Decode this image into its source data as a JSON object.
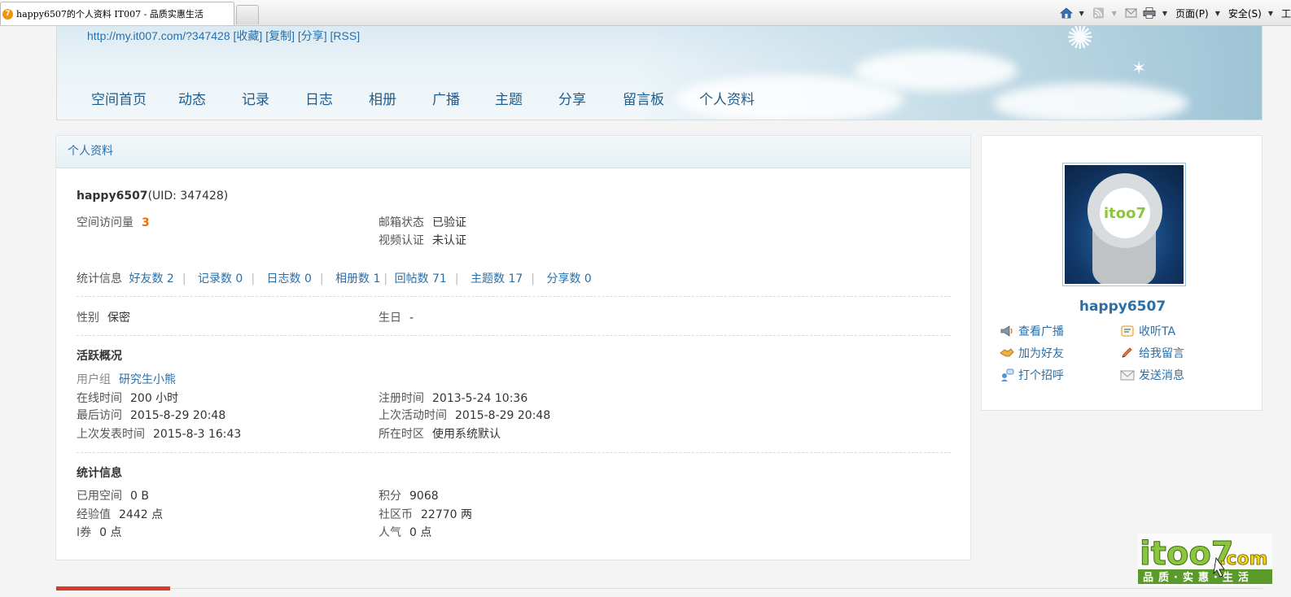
{
  "browser": {
    "tab_title": "happy6507的个人资料 IT007 - 品质实惠生活",
    "favicon_glyph": "7",
    "menu_page": "页面(P)",
    "menu_safety": "安全(S)",
    "menu_tools": "工"
  },
  "banner": {
    "url": "http://my.it007.com/?347428",
    "actions": [
      "[收藏]",
      "[复制]",
      "[分享]",
      "[RSS]"
    ]
  },
  "nav": [
    "空间首页",
    "动态",
    "记录",
    "日志",
    "相册",
    "广播",
    "主题",
    "分享",
    "留言板",
    "个人资料"
  ],
  "panel": {
    "title": "个人资料",
    "username": "happy6507",
    "uid": "(UID: 347428)",
    "visits_label": "空间访问量",
    "visits_value": "3",
    "email_label": "邮箱状态",
    "email_value": "已验证",
    "video_label": "视频认证",
    "video_value": "未认证",
    "stats_label": "统计信息",
    "stats": [
      "好友数 2",
      "记录数 0",
      "日志数 0",
      "相册数 1",
      "回帖数 71",
      "主题数 17",
      "分享数 0"
    ],
    "gender_label": "性别",
    "gender_value": "保密",
    "birthday_label": "生日",
    "birthday_value": "-",
    "activity_title": "活跃概况",
    "usergroup_label": "用户组",
    "usergroup_value": "研究生小熊",
    "online_label": "在线时间",
    "online_value": "200 小时",
    "register_label": "注册时间",
    "register_value": "2013-5-24 10:36",
    "lastvisit_label": "最后访问",
    "lastvisit_value": "2015-8-29 20:48",
    "lastactive_label": "上次活动时间",
    "lastactive_value": "2015-8-29 20:48",
    "lastpost_label": "上次发表时间",
    "lastpost_value": "2015-8-3 16:43",
    "timezone_label": "所在时区",
    "timezone_value": "使用系统默认",
    "statinfo_title": "统计信息",
    "space_label": "已用空间",
    "space_value": "0 B",
    "points_label": "积分",
    "points_value": "9068",
    "exp_label": "经验值",
    "exp_value": "2442 点",
    "coins_label": "社区币",
    "coins_value": "22770 两",
    "coupon_label": "I券",
    "coupon_value": "0 点",
    "popularity_label": "人气",
    "popularity_value": "0 点"
  },
  "side": {
    "avatar_text": "itoo7",
    "name": "happy6507",
    "actions": {
      "view_broadcast": "查看广播",
      "follow": "收听TA",
      "add_friend": "加为好友",
      "leave_message": "给我留言",
      "greet": "打个招呼",
      "send_message": "发送消息"
    }
  },
  "watermark": {
    "logo": "itoo7",
    "domain": ".com",
    "slogan": "品质·实惠·生活"
  },
  "colors": {
    "link": "#2a6fa8",
    "accent_orange": "#f26c00",
    "bottom_red": "#d73a2b"
  }
}
